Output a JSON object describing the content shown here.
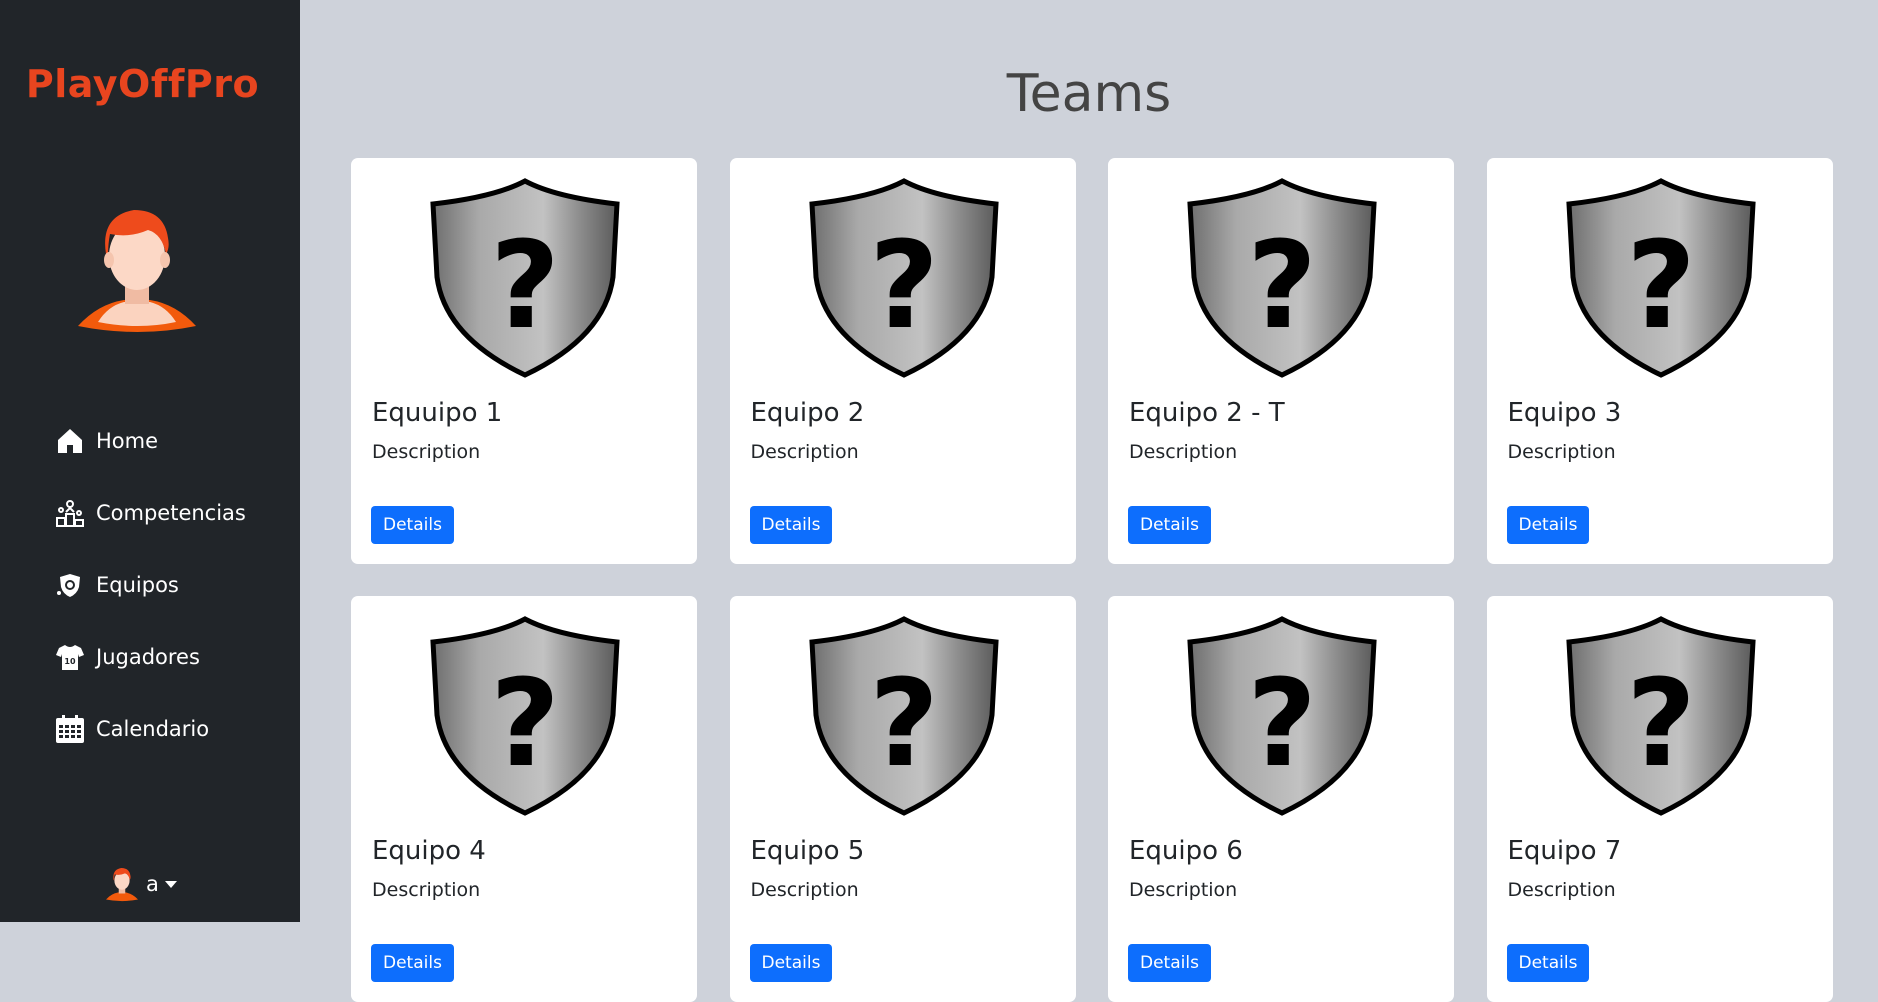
{
  "sidebar": {
    "brand": "PlayOffPro",
    "items": [
      {
        "label": "Home",
        "icon": "home-icon"
      },
      {
        "label": "Competencias",
        "icon": "trophy-podium-icon"
      },
      {
        "label": "Equipos",
        "icon": "team-shield-icon"
      },
      {
        "label": "Jugadores",
        "icon": "jersey-icon"
      },
      {
        "label": "Calendario",
        "icon": "calendar-icon"
      }
    ],
    "user": {
      "name": "a"
    }
  },
  "main": {
    "title": "Teams",
    "cards": [
      {
        "name": "Equuipo 1",
        "description": "Description",
        "button": "Details"
      },
      {
        "name": "Equipo 2",
        "description": "Description",
        "button": "Details"
      },
      {
        "name": "Equipo 2 - T",
        "description": "Description",
        "button": "Details"
      },
      {
        "name": "Equipo 3",
        "description": "Description",
        "button": "Details"
      },
      {
        "name": "Equipo 4",
        "description": "Description",
        "button": "Details"
      },
      {
        "name": "Equipo 5",
        "description": "Description",
        "button": "Details"
      },
      {
        "name": "Equipo 6",
        "description": "Description",
        "button": "Details"
      },
      {
        "name": "Equipo 7",
        "description": "Description",
        "button": "Details"
      }
    ]
  },
  "colors": {
    "brand": "#e8451f",
    "sidebar_bg": "#212529",
    "page_bg": "#ced2da",
    "button": "#0d6efd"
  }
}
